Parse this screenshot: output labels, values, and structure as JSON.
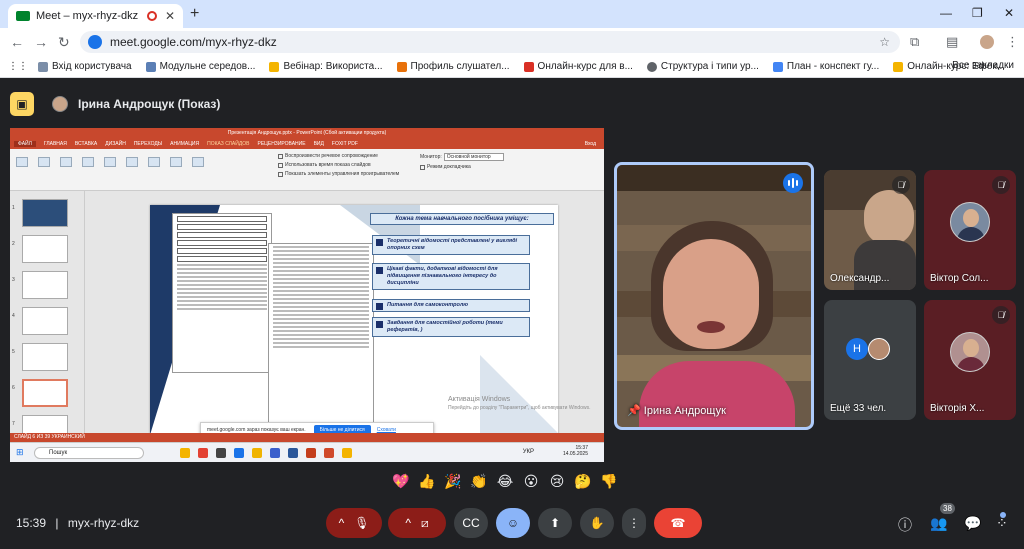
{
  "browser": {
    "tab_title": "Meet – myx-rhyz-dkz",
    "url": "meet.google.com/myx-rhyz-dkz",
    "bookmarks": [
      "Вхід користувача",
      "Модульне середов...",
      "Вебінар: Використа...",
      "Профиль слушател...",
      "Онлайн-курс для в...",
      "Структура і типи ур...",
      "План - конспект гу...",
      "Онлайн-курс: Ефек..."
    ],
    "all_bookmarks": "Все закладки"
  },
  "meet": {
    "presenter_label": "Ірина Андрощук (Показ)",
    "main_speaker": "Ірина Андрощук",
    "tiles": [
      {
        "name": "Олександр...",
        "muted": true
      },
      {
        "name": "Віктор Сол...",
        "muted": true
      },
      {
        "name": "Ещё 33 чел.",
        "muted": false,
        "more_letter": "Н"
      },
      {
        "name": "Вікторія Х...",
        "muted": true
      }
    ],
    "time": "15:39",
    "meeting_code": "myx-rhyz-dkz",
    "participants_count": "38",
    "reactions": [
      "💖",
      "👍",
      "🎉",
      "👏",
      "😂",
      "😮",
      "😢",
      "🤔",
      "👎"
    ]
  },
  "shared_screen": {
    "ppt_title": "Презентація Андрощук.pptx - PowerPoint (Сбой активации продукта)",
    "menu": [
      "ФАЙЛ",
      "ГЛАВНАЯ",
      "ВСТАВКА",
      "ДИЗАЙН",
      "ПЕРЕХОДЫ",
      "АНИМАЦИЯ",
      "ПОКАЗ СЛАЙДОВ",
      "РЕЦЕНЗИРОВАНИЕ",
      "ВИД",
      "FOXIT PDF"
    ],
    "signin": "Вход",
    "ribbon_checks": [
      "Воспроизвести речевое сопровождение",
      "Использовать время показа слайдов",
      "Показать элементы управления проигрывателем"
    ],
    "monitor_label": "Монитор:",
    "monitor_value": "Основной монитор",
    "presenter_mode": "Режим докладчика",
    "slide_header": "Кожна тема навчального посібника  уміщує:",
    "slide_bullets": [
      "Теоретичні відомості представлені у вигляді опорних схем",
      "Цікаві факти, додаткові відомості для підвищення пізнавального інтересу  до дисципліни",
      "Питання  для самоконтролю",
      "Завдання для самостійної роботи (теми рефератів, )"
    ],
    "status": "СЛАЙД 6 ИЗ 39    УКРАИНСКИЙ",
    "share_notice": "meet.google.com зараз показує ваш екран.",
    "stop_sharing": "Більше не ділитися",
    "hide": "Сховати",
    "watermark_title": "Активація Windows",
    "watermark_sub": "Перейдіть до розділу \"Параметри\", щоб активувати Windows.",
    "taskbar_search": "Пошук",
    "taskbar_time": "15:37",
    "taskbar_date": "14.05.2025",
    "lang": "УКР"
  }
}
